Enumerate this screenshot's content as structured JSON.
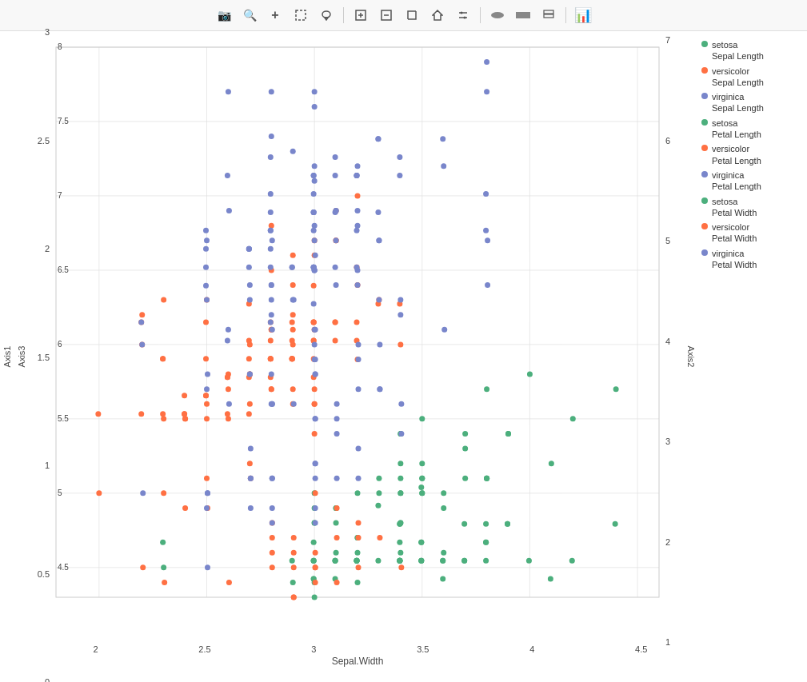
{
  "toolbar": {
    "buttons": [
      {
        "name": "camera-icon",
        "symbol": "📷"
      },
      {
        "name": "zoom-icon",
        "symbol": "🔍"
      },
      {
        "name": "plus-icon",
        "symbol": "+"
      },
      {
        "name": "select-icon",
        "symbol": "⬚"
      },
      {
        "name": "comment-icon",
        "symbol": "💬"
      },
      {
        "name": "add-box-icon",
        "symbol": "⊞"
      },
      {
        "name": "remove-box-icon",
        "symbol": "⊟"
      },
      {
        "name": "resize-icon",
        "symbol": "⤢"
      },
      {
        "name": "home-icon",
        "symbol": "⌂"
      },
      {
        "name": "options-icon",
        "symbol": "⁞"
      },
      {
        "name": "shape1-icon",
        "symbol": "▬"
      },
      {
        "name": "shape2-icon",
        "symbol": "▬"
      },
      {
        "name": "layers-icon",
        "symbol": "❏"
      },
      {
        "name": "bar-chart-icon",
        "symbol": "📊"
      }
    ]
  },
  "chart": {
    "x_axis": {
      "title": "Sepal.Width",
      "ticks": [
        "2",
        "2.5",
        "3",
        "3.5",
        "4",
        "4.5"
      ]
    },
    "y_left_axis": {
      "title": "Axis1",
      "ticks": [
        "0",
        "0.5",
        "1",
        "1.5",
        "2",
        "2.5",
        "3"
      ]
    },
    "y_axis3": {
      "title": "Axis3",
      "ticks": [
        "4.5",
        "5",
        "5.5",
        "6",
        "6.5",
        "7",
        "7.5",
        "8"
      ]
    },
    "y_right_axis": {
      "title": "Axis2",
      "ticks": [
        "1",
        "2",
        "3",
        "4",
        "5",
        "6",
        "7"
      ]
    }
  },
  "legend": {
    "items": [
      {
        "label": "setosa\nSepal Length",
        "color": "#4CAF7D",
        "type": "dot"
      },
      {
        "label": "versicolor\nSepal Length",
        "color": "#FF7043",
        "type": "dot"
      },
      {
        "label": "virginica\nSepal Length",
        "color": "#7986CB",
        "type": "dot"
      },
      {
        "label": "setosa\nPetal Length",
        "color": "#4CAF7D",
        "type": "dot"
      },
      {
        "label": "versicolor\nPetal Length",
        "color": "#FF7043",
        "type": "dot"
      },
      {
        "label": "virginica\nPetal Length",
        "color": "#7986CB",
        "type": "dot"
      },
      {
        "label": "setosa\nPetal Width",
        "color": "#4CAF7D",
        "type": "dot"
      },
      {
        "label": "versicolor\nPetal Width",
        "color": "#FF7043",
        "type": "dot"
      },
      {
        "label": "virginica\nPetal Width",
        "color": "#7986CB",
        "type": "dot"
      }
    ]
  },
  "colors": {
    "setosa": "#4CAF7D",
    "versicolor": "#FF7043",
    "virginica": "#7986CB",
    "grid": "#e0e0e0"
  }
}
